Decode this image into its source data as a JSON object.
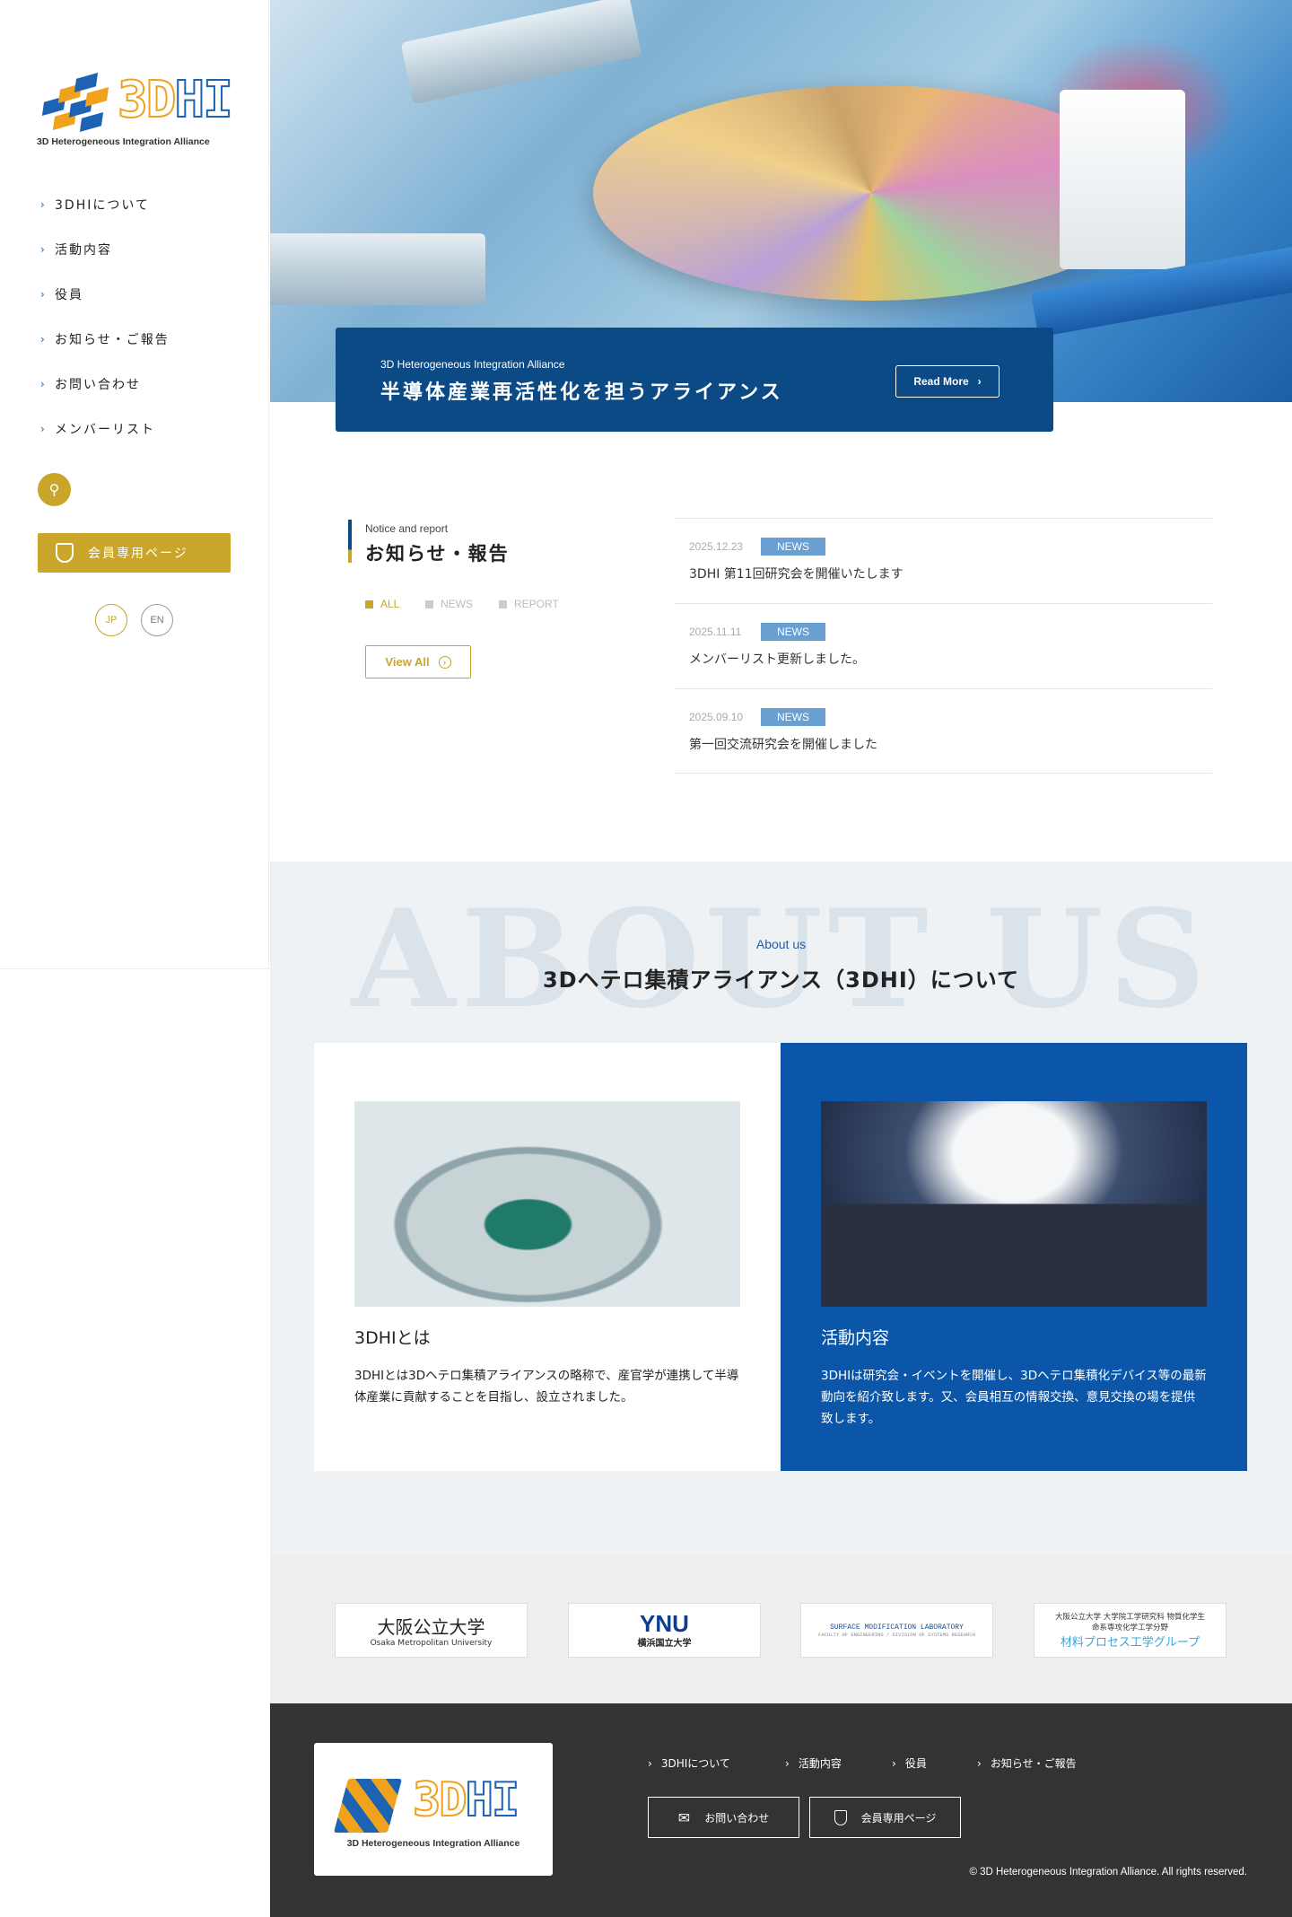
{
  "brand": {
    "name": "3DHI",
    "subtitle": "3D Heterogeneous Integration Alliance",
    "colors": {
      "navy": "#0c4a85",
      "gold": "#c9a52a",
      "blue": "#1c63b4",
      "orange": "#f0a21c"
    }
  },
  "sidebar": {
    "nav": [
      {
        "label": "3DHIについて"
      },
      {
        "label": "活動内容"
      },
      {
        "label": "役員"
      },
      {
        "label": "お知らせ・ご報告"
      },
      {
        "label": "お問い合わせ"
      },
      {
        "label": "メンバーリスト"
      }
    ],
    "search_icon": "search-icon",
    "member_button": "会員専用ページ",
    "lang": [
      "JP",
      "EN"
    ]
  },
  "hero": {
    "subtitle": "3D Heterogeneous Integration Alliance",
    "title": "半導体産業再活性化を担うアライアンス",
    "read_more": "Read More"
  },
  "news": {
    "label_en": "Notice and report",
    "label_jp": "お知らせ・報告",
    "filters": [
      "ALL",
      "NEWS",
      "REPORT"
    ],
    "view_all": "View All",
    "items": [
      {
        "date": "2025.12.23",
        "tag": "NEWS",
        "title": "3DHI 第11回研究会を開催いたします"
      },
      {
        "date": "2025.11.11",
        "tag": "NEWS",
        "title": "メンバーリスト更新しました。"
      },
      {
        "date": "2025.09.10",
        "tag": "NEWS",
        "title": "第一回交流研究会を開催しました"
      }
    ]
  },
  "about": {
    "label_en": "About us",
    "title": "3Dヘテロ集積アライアンス（3DHI）について",
    "watermark": "ABOUT US",
    "cards": [
      {
        "title": "3DHIとは",
        "text": "3DHIとは3Dヘテロ集積アライアンスの略称で、産官学が連携して半導体産業に貢献することを目指し、設立されました。"
      },
      {
        "title": "活動内容",
        "text": "3DHIは研究会・イベントを開催し、3Dヘテロ集積化デバイス等の最新動向を紹介致します。又、会員相互の情報交換、意見交換の場を提供致します。"
      }
    ]
  },
  "partners": [
    {
      "name": "大阪公立大学",
      "sub": "Osaka Metropolitan University"
    },
    {
      "name": "YNU",
      "sub": "横浜国立大学"
    },
    {
      "name": "SURFACE MODIFICATION LABORATORY",
      "sub": "FACULTY OF ENGINEERING / DIVISION OF SYSTEMS RESEARCH"
    },
    {
      "name": "材料プロセス工学グループ",
      "sub": "大阪公立大学 大学院工学研究科 物質化学生命系専攻化学工学分野"
    }
  ],
  "footer": {
    "links": [
      "3DHIについて",
      "活動内容",
      "役員",
      "お知らせ・ご報告"
    ],
    "contact_button": "お問い合わせ",
    "member_button": "会員専用ページ",
    "copyright": "© 3D Heterogeneous Integration Alliance. All rights reserved."
  }
}
